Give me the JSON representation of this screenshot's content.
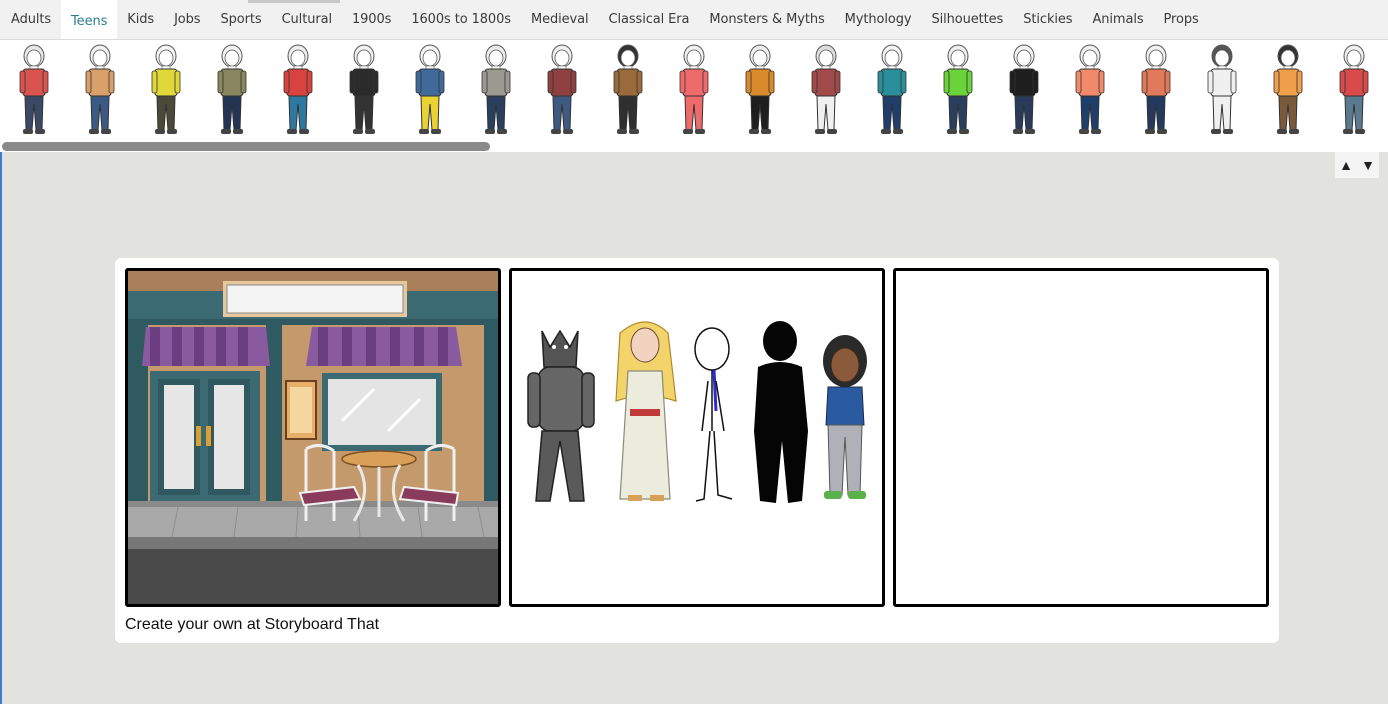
{
  "tabs": [
    {
      "label": "Adults"
    },
    {
      "label": "Teens",
      "active": true
    },
    {
      "label": "Kids"
    },
    {
      "label": "Jobs"
    },
    {
      "label": "Sports"
    },
    {
      "label": "Cultural"
    },
    {
      "label": "1900s"
    },
    {
      "label": "1600s to 1800s"
    },
    {
      "label": "Medieval"
    },
    {
      "label": "Classical Era"
    },
    {
      "label": "Monsters & Myths"
    },
    {
      "label": "Mythology"
    },
    {
      "label": "Silhouettes"
    },
    {
      "label": "Stickies"
    },
    {
      "label": "Animals"
    },
    {
      "label": "Props"
    }
  ],
  "characters": [
    {
      "shirt": "#d9534f",
      "pants": "#3a4a66",
      "hair": "#e8e8e8"
    },
    {
      "shirt": "#d9a06a",
      "pants": "#3b5b85",
      "hair": "#f0f0f0"
    },
    {
      "shirt": "#e0d83a",
      "pants": "#4a4a3a",
      "hair": "#f4f4f4"
    },
    {
      "shirt": "#8a8660",
      "pants": "#243554",
      "hair": "#f4f4f4"
    },
    {
      "shirt": "#d9433f",
      "pants": "#2f78a0",
      "hair": "#eeeeee"
    },
    {
      "shirt": "#2b2b2b",
      "pants": "#333333",
      "hair": "#f0f0f0"
    },
    {
      "shirt": "#3f6a9a",
      "pants": "#e8d234",
      "hair": "#f4f4f4"
    },
    {
      "shirt": "#9a9a92",
      "pants": "#2a3e5e",
      "hair": "#eeeeee"
    },
    {
      "shirt": "#8f4040",
      "pants": "#3e5a80",
      "hair": "#f0f0f0"
    },
    {
      "shirt": "#9a6a3a",
      "pants": "#2f2f2f",
      "hair": "#333333"
    },
    {
      "shirt": "#ef6a6a",
      "pants": "#ef6a6a",
      "hair": "#f0f0f0"
    },
    {
      "shirt": "#d98a2a",
      "pants": "#1e1e1e",
      "hair": "#f0f0f0"
    },
    {
      "shirt": "#a04a4a",
      "pants": "#f0f0f0",
      "hair": "#dddddd"
    },
    {
      "shirt": "#2a8f9a",
      "pants": "#1f3e6a",
      "hair": "#f4f4f4"
    },
    {
      "shirt": "#6ad23a",
      "pants": "#2a3e5e",
      "hair": "#eeeeee"
    },
    {
      "shirt": "#1e1e1e",
      "pants": "#2a3a5a",
      "hair": "#f4f4f4"
    },
    {
      "shirt": "#f08a6a",
      "pants": "#1f3e6a",
      "hair": "#f0f0f0"
    },
    {
      "shirt": "#e07a5a",
      "pants": "#233a5e",
      "hair": "#f0f0f0"
    },
    {
      "shirt": "#f0f0f0",
      "pants": "#f0f0f0",
      "hair": "#555555"
    },
    {
      "shirt": "#f0a04a",
      "pants": "#7a5a3a",
      "hair": "#333333"
    },
    {
      "shirt": "#d94a4a",
      "pants": "#5a7a90",
      "hair": "#f0f0f0"
    }
  ],
  "controls": {
    "up_arrow": "▲",
    "down_arrow": "▼"
  },
  "storyboard": {
    "footer": "Create your own at Storyboard That"
  }
}
